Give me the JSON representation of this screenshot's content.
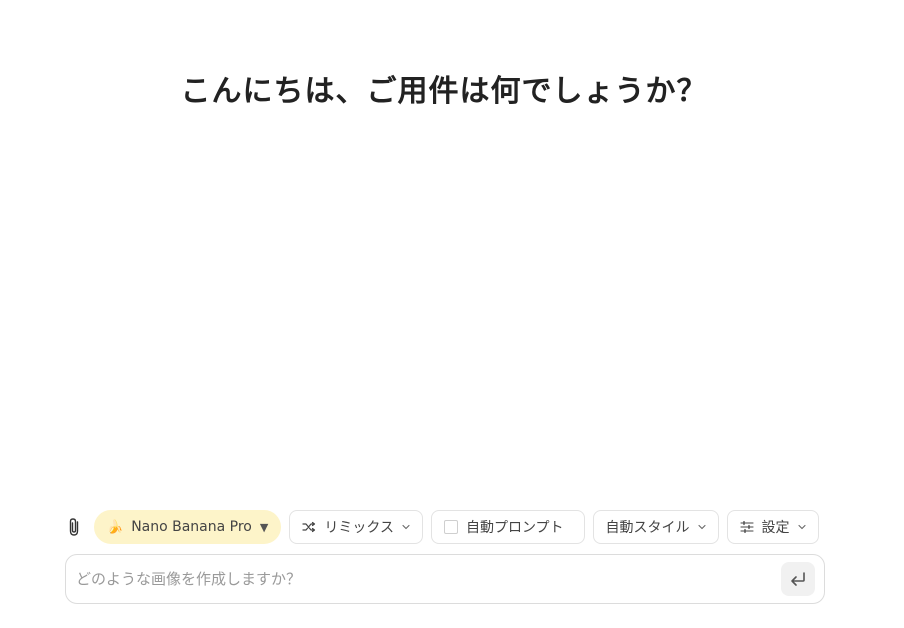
{
  "greeting": "こんにちは、ご用件は何でしょうか？",
  "toolbar": {
    "model": {
      "emoji": "🍌",
      "label": "Nano Banana Pro",
      "caret": "▼"
    },
    "remix_label": "リミックス",
    "auto_prompt_label": "自動プロンプト",
    "auto_prompt_checked": false,
    "auto_style_label": "自動スタイル",
    "settings_label": "設定"
  },
  "prompt": {
    "placeholder": "どのような画像を作成しますか？",
    "value": ""
  },
  "icons": {
    "attach": "paperclip-icon",
    "remix": "shuffle-icon",
    "settings": "sliders-icon",
    "send": "enter-arrow-icon",
    "dropdown": "chevron-down-icon"
  },
  "colors": {
    "model_chip_bg": "#fdf4c9",
    "border": "#e3e3e3",
    "placeholder": "#9a9a9a"
  }
}
